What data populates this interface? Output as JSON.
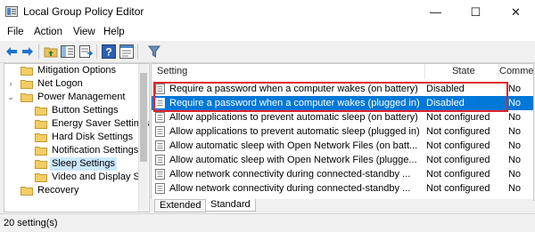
{
  "window": {
    "title": "Local Group Policy Editor",
    "min_glyph": "—",
    "max_glyph": "☐",
    "close_glyph": "✕"
  },
  "menu": [
    "File",
    "Action",
    "View",
    "Help"
  ],
  "toolbar": {
    "icons": [
      "back-arrow-icon",
      "forward-arrow-icon",
      "folder-up-icon",
      "show-hide-tree-icon",
      "export-list-icon",
      "help-icon",
      "properties-icon",
      "filter-icon"
    ]
  },
  "tree": {
    "items": [
      {
        "label": "Mitigation Options",
        "level": 1,
        "expandable": false,
        "selected": false
      },
      {
        "label": "Net Logon",
        "level": 1,
        "expandable": true,
        "selected": false
      },
      {
        "label": "Power Management",
        "level": 1,
        "expandable": true,
        "expanded": true,
        "selected": false
      },
      {
        "label": "Button Settings",
        "level": 2,
        "expandable": false,
        "selected": false
      },
      {
        "label": "Energy Saver Settings",
        "level": 2,
        "expandable": false,
        "selected": false
      },
      {
        "label": "Hard Disk Settings",
        "level": 2,
        "expandable": false,
        "selected": false
      },
      {
        "label": "Notification Settings",
        "level": 2,
        "expandable": false,
        "selected": false
      },
      {
        "label": "Sleep Settings",
        "level": 2,
        "expandable": false,
        "selected": true
      },
      {
        "label": "Video and Display Set",
        "level": 2,
        "expandable": false,
        "selected": false
      },
      {
        "label": "Recovery",
        "level": 1,
        "expandable": false,
        "selected": false
      }
    ]
  },
  "list": {
    "columns": {
      "setting": "Setting",
      "state": "State",
      "comment": "Comment"
    },
    "rows": [
      {
        "setting": "Require a password when a computer wakes (on battery)",
        "state": "Disabled",
        "comment": "No",
        "selected": false
      },
      {
        "setting": "Require a password when a computer wakes (plugged in)",
        "state": "Disabled",
        "comment": "No",
        "selected": true
      },
      {
        "setting": "Allow applications to prevent automatic sleep (on battery)",
        "state": "Not configured",
        "comment": "No",
        "selected": false
      },
      {
        "setting": "Allow applications to prevent automatic sleep (plugged in)",
        "state": "Not configured",
        "comment": "No",
        "selected": false
      },
      {
        "setting": "Allow automatic sleep with Open Network Files (on batt...",
        "state": "Not configured",
        "comment": "No",
        "selected": false
      },
      {
        "setting": "Allow automatic sleep with Open Network Files (plugge...",
        "state": "Not configured",
        "comment": "No",
        "selected": false
      },
      {
        "setting": "Allow network connectivity during connected-standby ...",
        "state": "Not configured",
        "comment": "No",
        "selected": false
      },
      {
        "setting": "Allow network connectivity during connected-standby ...",
        "state": "Not configured",
        "comment": "No",
        "selected": false
      }
    ]
  },
  "tabs": {
    "extended": "Extended",
    "standard": "Standard"
  },
  "status": {
    "text": "20 setting(s)"
  },
  "colors": {
    "selection": "#0078d7",
    "highlight_box": "#e0252b",
    "tree_selection": "#cce8ff"
  }
}
